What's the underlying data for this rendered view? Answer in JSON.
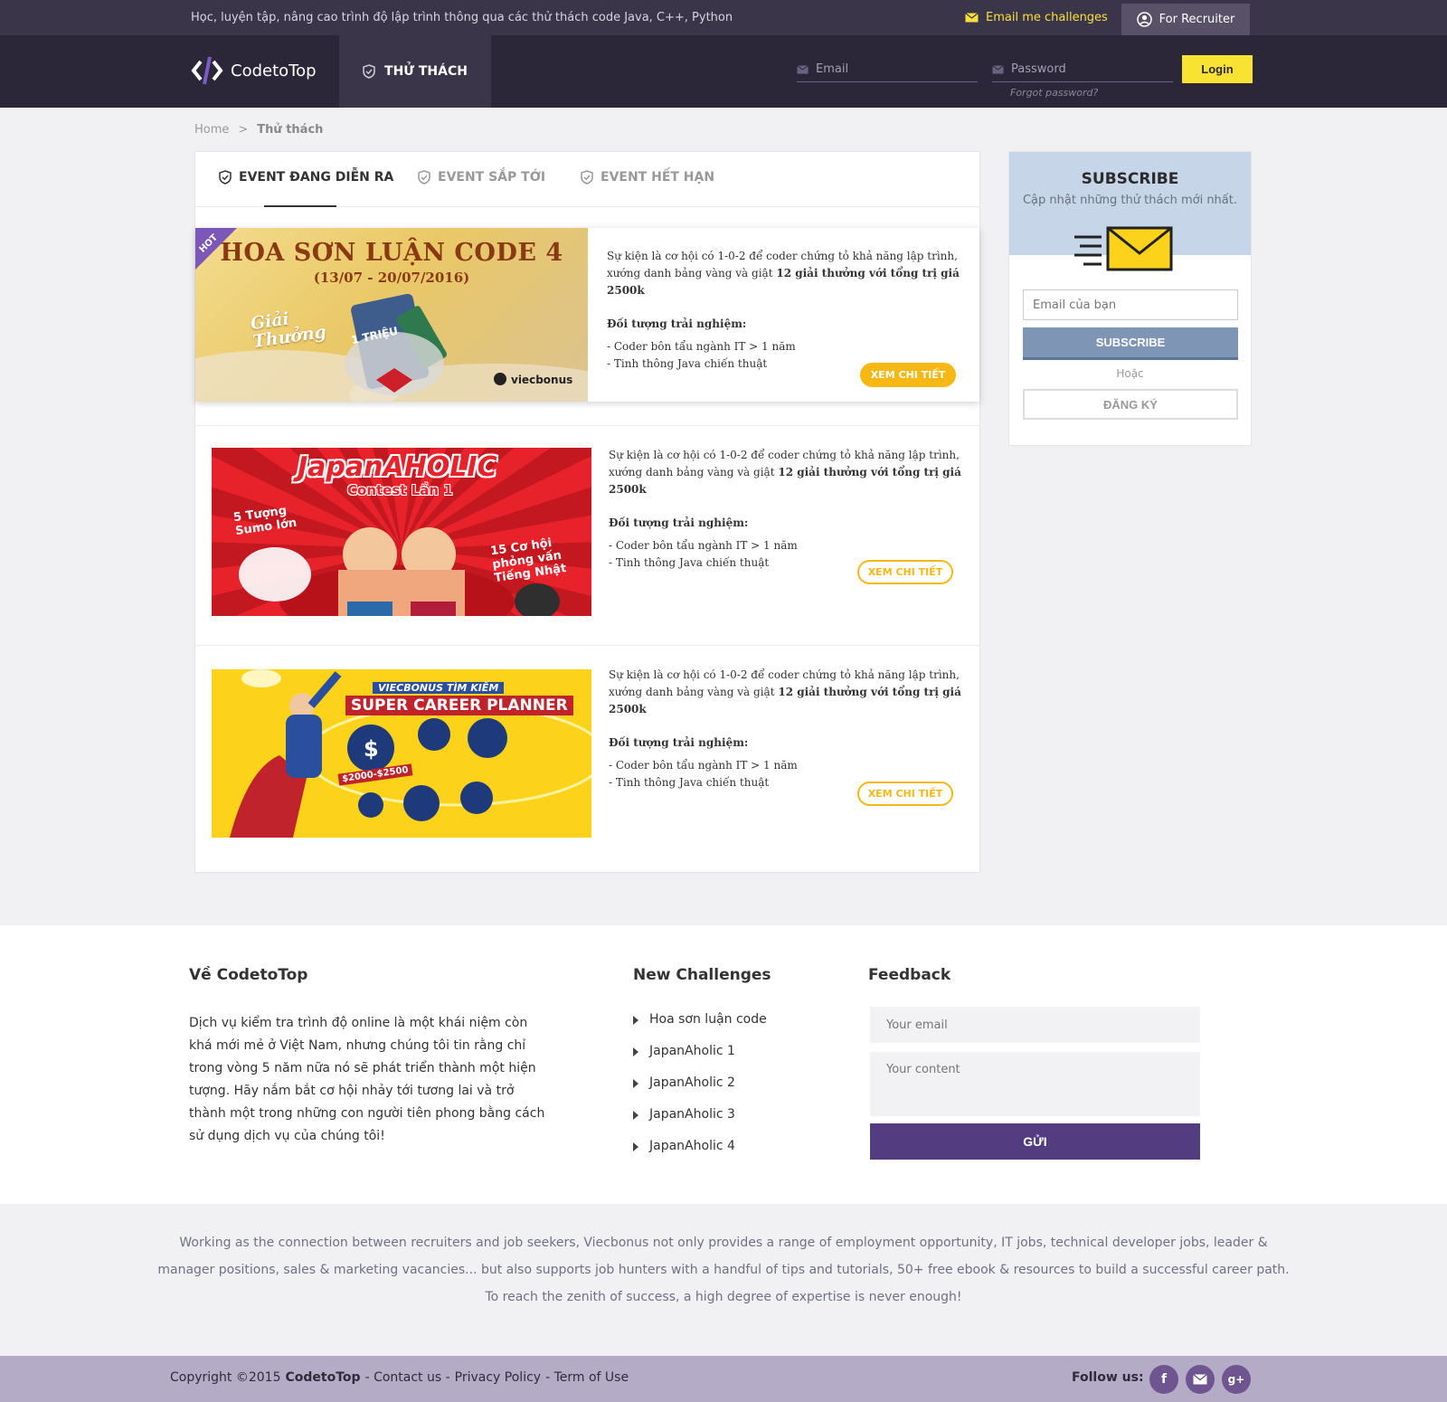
{
  "topbar": {
    "tagline": "Học, luyện tập, nâng cao trình độ lập trình thông qua các thử thách code Java, C++, Python",
    "email_challenges": "Email me challenges",
    "recruiter": "For Recruiter"
  },
  "header": {
    "logo": "CodetoTop",
    "nav_tab": "THỬ THÁCH",
    "email_placeholder": "Email",
    "password_placeholder": "Password",
    "forgot": "Forgot password?",
    "login": "Login"
  },
  "breadcrumb": {
    "home": "Home",
    "sep": ">",
    "current": "Thử thách"
  },
  "tabs": [
    "EVENT ĐANG DIỄN RA",
    "EVENT SẮP TỚI",
    "EVENT HẾT HẠN"
  ],
  "events": [
    {
      "hot": "HOT",
      "banner_title": "HOA SƠN LUẬN CODE 4",
      "banner_date": "(13/07 - 20/07/2016)",
      "banner_prize": "Giải Thưởng",
      "banner_voucher": "1 TRIỆU",
      "banner_brand": "viecbonus",
      "desc_1": "Sự kiện là cơ hội có 1-0-2 để coder chứng tỏ khả năng lập trình, xướng danh bảng vàng và giật ",
      "desc_bold": "12 giải thưởng với tổng trị giá 2500k",
      "target_label": "Đối tượng trải nghiệm:",
      "target_1": "- Coder bôn tẩu ngành IT > 1 năm",
      "target_2": "- Tinh thông Java chiến thuật",
      "button": "XEM CHI TIẾT"
    },
    {
      "banner_title": "JapanAHOLIC",
      "banner_sub": "Contest Lần 1",
      "banner_left": "5 Tượng Sumo lớn",
      "banner_right": "15 Cơ hội phỏng vấn Tiếng Nhật",
      "desc_1": "Sự kiện là cơ hội có 1-0-2 để coder chứng tỏ khả năng lập trình, xướng danh bảng vàng và giật ",
      "desc_bold": "12 giải thưởng với tổng trị giá 2500k",
      "target_label": "Đối tượng trải nghiệm:",
      "target_1": "- Coder bôn tẩu ngành IT > 1 năm",
      "target_2": "- Tinh thông Java chiến thuật",
      "button": "XEM CHI TIẾT"
    },
    {
      "banner_top": "VIECBONUS TÌM KIẾM",
      "banner_title": "SUPER CAREER PLANNER",
      "banner_price": "$2000-$2500",
      "desc_1": "Sự kiện là cơ hội có 1-0-2 để coder chứng tỏ khả năng lập trình, xướng danh bảng vàng và giật ",
      "desc_bold": "12 giải thưởng với tổng trị giá 2500k",
      "target_label": "Đối tượng trải nghiệm:",
      "target_1": "- Coder bôn tẩu ngành IT > 1 năm",
      "target_2": "- Tinh thông Java chiến thuật",
      "button": "XEM CHI TIẾT"
    }
  ],
  "subscribe": {
    "title": "SUBSCRIBE",
    "subtitle": "Cập nhật những thử thách mới nhất.",
    "email_placeholder": "Email của bạn",
    "button": "SUBSCRIBE",
    "or": "Hoặc",
    "register": "ĐĂNG KÝ"
  },
  "footer": {
    "about_title": "Về CodetoTop",
    "about_text": "Dịch vụ kiểm tra trình độ online là một khái niệm còn khá mới mẻ ở Việt Nam, nhưng chúng tôi tin rằng chỉ trong vòng 5 năm nữa nó sẽ phát triển thành một hiện tượng. Hãy nắm bắt cơ hội nhảy tới tương lai và trở thành một trong những con người tiên phong bằng cách sử dụng dịch vụ của chúng tôi!",
    "challenges_title": "New Challenges",
    "challenges": [
      "Hoa sơn luận code",
      "JapanAholic 1",
      "JapanAholic 2",
      "JapanAholic 3",
      "JapanAholic 4"
    ],
    "feedback_title": "Feedback",
    "feedback_email": "Your email",
    "feedback_content": "Your content",
    "send": "GỬI"
  },
  "about_strip": "Working as the connection between recruiters and job seekers, Viecbonus not only provides a range of employment opportunity, IT jobs, technical developer jobs, leader & manager positions, sales & marketing vacancies... but also supports job hunters with a handful of tips and tutorials, 50+ free ebook & resources to build a successful career path. To reach the zenith of success, a high degree of expertise is never enough!",
  "bottom": {
    "copyright": "Copyright ©2015",
    "brand": "CodetoTop",
    "contact": "- Contact us -",
    "privacy": "Privacy Policy",
    "terms": "- Term of Use",
    "follow": "Follow us:"
  },
  "colors": {
    "accent_yellow": "#f8e232",
    "button_orange": "#f8b814",
    "header_dark": "#2c2639",
    "footer_purple": "#533c7f"
  }
}
